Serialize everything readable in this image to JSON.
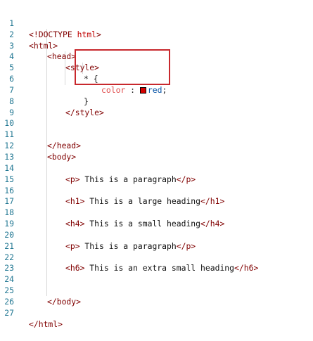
{
  "editor": {
    "line_numbers": [
      "1",
      "2",
      "3",
      "4",
      "5",
      "6",
      "7",
      "8",
      "9",
      "10",
      "11",
      "12",
      "13",
      "14",
      "15",
      "16",
      "17",
      "18",
      "19",
      "20",
      "21",
      "22",
      "23",
      "24",
      "25",
      "26",
      "27"
    ],
    "code": {
      "l1_open": "<!DOCTYPE ",
      "l1_html": "html",
      "l1_close": ">",
      "l2": "<html>",
      "l3": "<head>",
      "l4": "<style>",
      "l5": "* {",
      "l6_prop": "color",
      "l6_colon": " : ",
      "l6_val": "red",
      "l6_semi": ";",
      "l7": "}",
      "l8": "</style>",
      "l11": "</head>",
      "l12": "<body>",
      "l14_open": "<p>",
      "l14_text": " This is a paragraph",
      "l14_close": "</p>",
      "l16_open": "<h1>",
      "l16_text": " This is a large heading",
      "l16_close": "</h1>",
      "l18_open": "<h4>",
      "l18_text": " This is a small heading",
      "l18_close": "</h4>",
      "l20_open": "<p>",
      "l20_text": " This is a paragraph",
      "l20_close": "</p>",
      "l22_open": "<h6>",
      "l22_text": " This is an extra small heading",
      "l22_close": "</h6>",
      "l25": "</body>",
      "l27": "</html>"
    },
    "colors": {
      "highlight_border": "#c8282d",
      "swatch": "#d40000",
      "line_number": "#237893",
      "tag": "#800000",
      "value": "#0451a5"
    }
  }
}
